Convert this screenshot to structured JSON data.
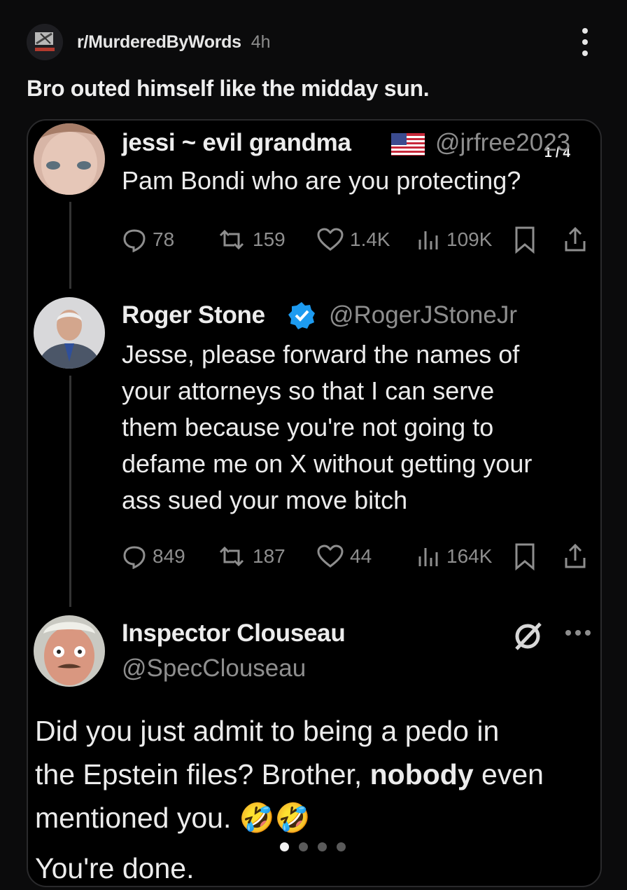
{
  "post": {
    "subreddit": "r/MurderedByWords",
    "time": "4h",
    "title": "Bro outed himself like the midday sun.",
    "image_page": "1 / 4",
    "carousel_dots": 4,
    "carousel_active": 1
  },
  "tweets": [
    {
      "name": "jessi ~ evil grandma",
      "flag_icon": "us-flag-icon",
      "handle": "@jrfree2023",
      "text_lines": [
        "Pam Bondi who are you protecting?"
      ],
      "replies": "78",
      "reposts": "159",
      "likes": "1.4K",
      "views": "109K"
    },
    {
      "name": "Roger Stone",
      "verified_icon": "verified-badge-icon",
      "handle": "@RogerJStoneJr",
      "text_lines": [
        "Jesse, please forward the names of",
        "your attorneys so that I can serve",
        "them because you're not going to",
        "defame me on X without getting your",
        "ass sued your move bitch"
      ],
      "replies": "849",
      "reposts": "187",
      "likes": "44",
      "views": "164K"
    },
    {
      "name": "Inspector Clouseau",
      "handle": "@SpecClouseau",
      "line1": "Did you just admit to being a pedo in",
      "line2_pre": "the Epstein files? Brother, ",
      "line2_bold": "nobody",
      "line2_post": " even",
      "line3": "mentioned you.",
      "emoji": "🤣🤣",
      "line4": "You're done."
    }
  ],
  "colors": {
    "background": "#0b0b0c",
    "card": "#000000",
    "verified": "#1d9bf0",
    "muted": "#8e8e8e"
  }
}
